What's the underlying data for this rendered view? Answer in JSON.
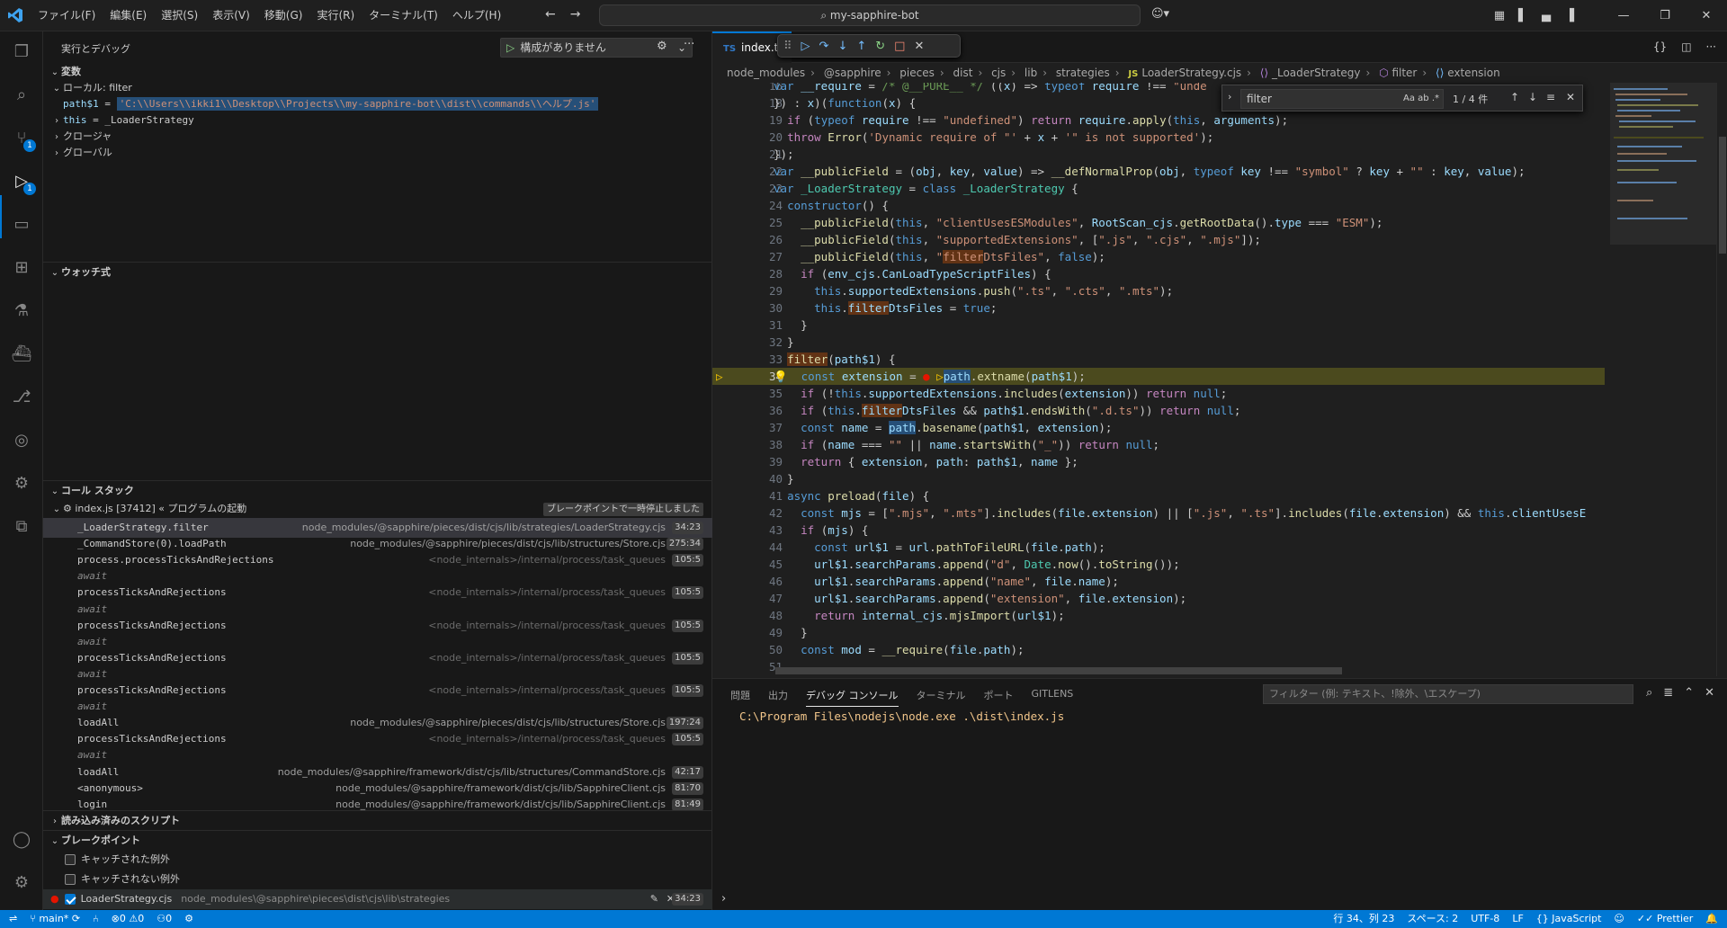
{
  "titlebar": {
    "menu": [
      "ファイル(F)",
      "編集(E)",
      "選択(S)",
      "表示(V)",
      "移動(G)",
      "実行(R)",
      "ターミナル(T)",
      "ヘルプ(H)"
    ],
    "search": "my-sapphire-bot"
  },
  "sidebar": {
    "title": "実行とデバッグ",
    "run_config": "構成がありません",
    "variables_header": "変数",
    "local_header": "ローカル: filter",
    "var_path_name": "path$1",
    "var_path_eq": " = ",
    "var_path_value": "'C:\\\\Users\\\\ikki1\\\\Desktop\\\\Projects\\\\my-sapphire-bot\\\\dist\\\\commands\\\\ヘルプ.js'",
    "var_this_name": "this",
    "var_this_value": " = _LoaderStrategy",
    "closure_header": "クロージャ",
    "global_header": "グローバル",
    "watch_header": "ウォッチ式",
    "callstack_header": "コール スタック",
    "callstack_root": "index.js [37412] « プログラムの起動",
    "paused_badge": "ブレークポイントで一時停止しました",
    "stack": [
      {
        "fn": "_LoaderStrategy.filter",
        "file": "node_modules/@sapphire/pieces/dist/cjs/lib/strategies/LoaderStrategy.cjs",
        "line": "34:23"
      },
      {
        "fn": "_CommandStore(0).loadPath",
        "file": "node_modules/@sapphire/pieces/dist/cjs/lib/structures/Store.cjs",
        "line": "275:34"
      },
      {
        "fn": "process.processTicksAndRejections",
        "file": "<node_internals>/internal/process/task_queues",
        "line": "105:5"
      },
      {
        "fn": "await"
      },
      {
        "fn": "processTicksAndRejections",
        "file": "<node_internals>/internal/process/task_queues",
        "line": "105:5"
      },
      {
        "fn": "await"
      },
      {
        "fn": "processTicksAndRejections",
        "file": "<node_internals>/internal/process/task_queues",
        "line": "105:5"
      },
      {
        "fn": "await"
      },
      {
        "fn": "processTicksAndRejections",
        "file": "<node_internals>/internal/process/task_queues",
        "line": "105:5"
      },
      {
        "fn": "await"
      },
      {
        "fn": "processTicksAndRejections",
        "file": "<node_internals>/internal/process/task_queues",
        "line": "105:5"
      },
      {
        "fn": "await"
      },
      {
        "fn": "loadAll",
        "file": "node_modules/@sapphire/pieces/dist/cjs/lib/structures/Store.cjs",
        "line": "197:24"
      },
      {
        "fn": "processTicksAndRejections",
        "file": "<node_internals>/internal/process/task_queues",
        "line": "105:5"
      },
      {
        "fn": "await"
      },
      {
        "fn": "loadAll",
        "file": "node_modules/@sapphire/framework/dist/cjs/lib/structures/CommandStore.cjs",
        "line": "42:17"
      },
      {
        "fn": "<anonymous>",
        "file": "node_modules/@sapphire/framework/dist/cjs/lib/SapphireClient.cjs",
        "line": "81:70"
      },
      {
        "fn": "login",
        "file": "node_modules/@sapphire/framework/dist/cjs/lib/SapphireClient.cjs",
        "line": "81:49"
      }
    ],
    "loaded_scripts_header": "読み込み済みのスクリプト",
    "breakpoints_header": "ブレークポイント",
    "bp_caught": "キャッチされた例外",
    "bp_uncaught": "キャッチされない例外",
    "bp_file": "LoaderStrategy.cjs",
    "bp_path": "node_modules\\@sapphire\\pieces\\dist\\cjs\\lib\\strategies",
    "bp_line": "34:23"
  },
  "editor": {
    "tab_label": "index.t",
    "tab_lang": "TS",
    "breadcrumb": [
      "node_modules",
      "@sapphire",
      "pieces",
      "dist",
      "cjs",
      "lib",
      "strategies",
      "LoaderStrategy.cjs",
      "_LoaderStrategy",
      "filter",
      "extension"
    ],
    "find": {
      "query": "filter",
      "count": "1 / 4 件",
      "options": "Aa ab .*"
    },
    "lines": [
      "16",
      "17",
      "18",
      "19",
      "20",
      "21",
      "22",
      "23",
      "24",
      "25",
      "26",
      "27",
      "28",
      "29",
      "30",
      "31",
      "32",
      "33",
      "34",
      "35",
      "36",
      "37",
      "38",
      "39",
      "40",
      "41",
      "42",
      "43",
      "44",
      "45",
      "46",
      "47",
      "48",
      "49",
      "50",
      "51"
    ],
    "current_line": "34"
  },
  "panel": {
    "tabs": [
      "問題",
      "出力",
      "デバッグ コンソール",
      "ターミナル",
      "ポート",
      "GITLENS"
    ],
    "filter_placeholder": "フィルター (例: テキスト、!除外、\\エスケープ)",
    "console_text": "C:\\Program Files\\nodejs\\node.exe .\\dist\\index.js"
  },
  "statusbar": {
    "branch": "main*",
    "errors": "0",
    "warnings": "0",
    "ports": "0",
    "position": "行 34、列 23",
    "spaces": "スペース: 2",
    "encoding": "UTF-8",
    "eol": "LF",
    "language": "JavaScript",
    "formatter": "Prettier"
  },
  "colors": {
    "accent": "#0078d4",
    "current_line": "#4b4a1e",
    "breakpoint": "#e51400"
  }
}
